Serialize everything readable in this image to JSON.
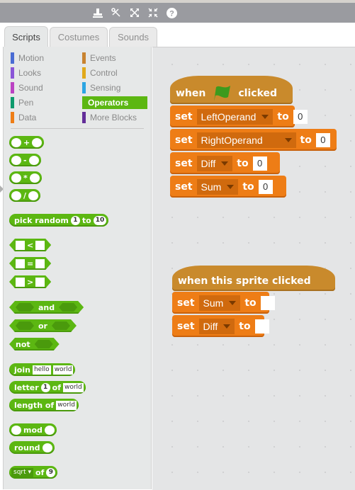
{
  "toolbar": {
    "tools": [
      {
        "icon": "stamp-icon",
        "label": "Duplicate"
      },
      {
        "icon": "scissors-icon",
        "label": "Delete"
      },
      {
        "icon": "grow-icon",
        "label": "Grow"
      },
      {
        "icon": "shrink-icon",
        "label": "Shrink"
      },
      {
        "icon": "help-icon",
        "label": "Block help"
      }
    ]
  },
  "tabs": [
    {
      "label": "Scripts",
      "active": true
    },
    {
      "label": "Costumes",
      "active": false
    },
    {
      "label": "Sounds",
      "active": false
    }
  ],
  "categories": [
    {
      "label": "Motion",
      "color": "#4a6cd4"
    },
    {
      "label": "Looks",
      "color": "#8a55d7"
    },
    {
      "label": "Sound",
      "color": "#bb42c3"
    },
    {
      "label": "Pen",
      "color": "#0e9a6c"
    },
    {
      "label": "Data",
      "color": "#ee7d16"
    },
    {
      "label": "Events",
      "color": "#c88330"
    },
    {
      "label": "Control",
      "color": "#e1a91a"
    },
    {
      "label": "Sensing",
      "color": "#2ca5e2"
    },
    {
      "label": "Operators",
      "color": "#5cb712",
      "active": true
    },
    {
      "label": "More Blocks",
      "color": "#632d99"
    }
  ],
  "palette": {
    "add_op": "+",
    "sub_op": "-",
    "mul_op": "*",
    "div_op": "/",
    "pick_random": {
      "label1": "pick random",
      "from": "1",
      "label2": "to",
      "to": "10"
    },
    "lt_op": "<",
    "eq_op": "=",
    "gt_op": ">",
    "and_label": "and",
    "or_label": "or",
    "not_label": "not",
    "join": {
      "label": "join",
      "a": "hello",
      "b": "world"
    },
    "letter": {
      "label1": "letter",
      "index": "1",
      "label2": "of",
      "text": "world"
    },
    "length": {
      "label": "length of",
      "text": "world"
    },
    "mod_label": "mod",
    "round_label": "round",
    "sqrt": {
      "func": "sqrt",
      "label": "of",
      "value": "9"
    }
  },
  "scripts": {
    "script1": {
      "hat": {
        "when": "when",
        "clicked": "clicked"
      },
      "blocks": [
        {
          "set": "set",
          "var": "LeftOperand",
          "to": "to",
          "value": "0"
        },
        {
          "set": "set",
          "var": "RightOperand",
          "to": "to",
          "value": "0"
        },
        {
          "set": "set",
          "var": "Diff",
          "to": "to",
          "value": "0"
        },
        {
          "set": "set",
          "var": "Sum",
          "to": "to",
          "value": "0"
        }
      ]
    },
    "script2": {
      "hat": {
        "label": "when this sprite clicked"
      },
      "blocks": [
        {
          "set": "set",
          "var": "Sum",
          "to": "to",
          "value": ""
        },
        {
          "set": "set",
          "var": "Diff",
          "to": "to",
          "value": ""
        }
      ]
    }
  },
  "colors": {
    "operators": "#5cb712",
    "data": "#ee7d16",
    "events": "#c98a2c",
    "flag": "#3d9a1d"
  }
}
